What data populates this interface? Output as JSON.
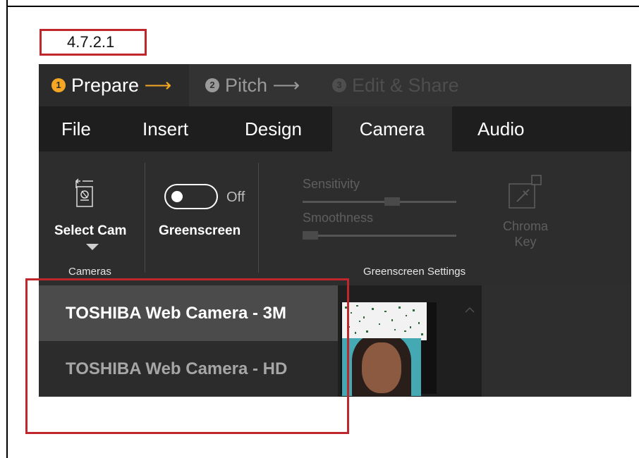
{
  "step_label": "4.7.2.1",
  "steps": [
    {
      "number": "1",
      "label": "Prepare",
      "arrow": "⟶"
    },
    {
      "number": "2",
      "label": "Pitch",
      "arrow": "⟶"
    },
    {
      "number": "3",
      "label": "Edit & Share"
    }
  ],
  "menu": [
    "File",
    "Insert",
    "Design",
    "Camera",
    "Audio"
  ],
  "ribbon": {
    "select_cam": "Select Cam",
    "cameras_group": "Cameras",
    "toggle_state": "Off",
    "greenscreen": "Greenscreen",
    "sensitivity": "Sensitivity",
    "smoothness": "Smoothness",
    "chroma_key_line1": "Chroma",
    "chroma_key_line2": "Key",
    "greenscreen_settings": "Greenscreen Settings"
  },
  "camera_options": [
    {
      "label": "TOSHIBA Web Camera - 3M",
      "selected": true
    },
    {
      "label": "TOSHIBA Web Camera - HD",
      "selected": false
    }
  ],
  "colors": {
    "accent": "#f5a623",
    "highlight": "#c0272d"
  },
  "icons": [
    "camera-switch-icon",
    "chevron-down-icon",
    "toggle-switch",
    "eyedropper-icon",
    "chevron-up-icon"
  ]
}
